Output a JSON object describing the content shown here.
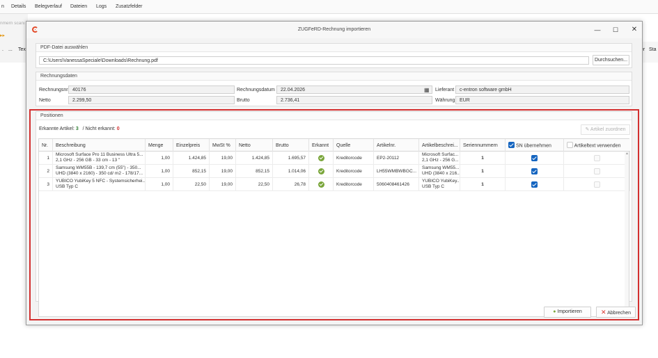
{
  "background": {
    "tabs": [
      {
        "label": "n"
      },
      {
        "label": "Details"
      },
      {
        "label": "Belegverlauf"
      },
      {
        "label": "Dateien"
      },
      {
        "label": "Logs"
      },
      {
        "label": "Zusatzfelder"
      }
    ],
    "scan_hint": "nmern scanı",
    "toolbar_snips": [
      ".",
      "...",
      "Tex"
    ],
    "right_snips": [
      "er",
      "Sta"
    ]
  },
  "dialog": {
    "title": "ZUGFeRD-Rechnung importieren",
    "pdf_group": {
      "title": "PDF-Datei auswählen",
      "path": "C:\\Users\\VanessaSpeciale\\Downloads\\Rechnung.pdf",
      "browse_label": "Durchsuchen..."
    },
    "invoice_group": {
      "title": "Rechnungsdaten",
      "number_label": "Rechnungsnr.",
      "number": "40176",
      "date_label": "Rechnungsdatum",
      "date": "22.04.2026",
      "supplier_label": "Lieferant",
      "supplier": "c-entron software gmbH",
      "net_label": "Netto",
      "net": "2.299,50",
      "gross_label": "Brutto",
      "gross": "2.736,41",
      "currency_label": "Währung",
      "currency": "EUR"
    },
    "positions": {
      "title": "Positionen",
      "recognized_label": "Erkannte Artikel:",
      "recognized_count": "3",
      "unrecognized_label": "/ Nicht erkannt:",
      "unrecognized_count": "0",
      "assign_label": "Artikel zuordnen",
      "columns": {
        "nr": "Nr.",
        "desc": "Beschreibung",
        "qty": "Menge",
        "unit": "Einzelpreis",
        "vat": "MwSt %",
        "net": "Netto",
        "gross": "Brutto",
        "recognized": "Erkannt",
        "source": "Quelle",
        "artno": "Artikelnr.",
        "artdesc": "Artikelbeschrei...",
        "serial": "Seriennummern",
        "sn": "SN übernehmen",
        "arttext": "Artikeltext verwenden"
      },
      "rows": [
        {
          "nr": "1",
          "desc1": "Microsoft Surface Pro 11 Business Ultra 5...",
          "desc2": "2,1 GHz - 256 GB - 33 cm - 13 \"",
          "qty": "1,00",
          "unit": "1.424,85",
          "vat": "19,00",
          "net": "1.424,85",
          "gross": "1.695,57",
          "source": "Kreditorcode",
          "artno": "EP2-20112",
          "artdesc1": "Microsoft Surfac...",
          "artdesc2": "2,1 GHz - 256 G...",
          "serial": "1",
          "sn": true,
          "arttext": false
        },
        {
          "nr": "2",
          "desc1": "Samsung WM55B - 139,7 cm (55\") - 350...",
          "desc2": "UHD (3840 x 2160) - 350 cd/ m2 - 178/17...",
          "qty": "1,00",
          "unit": "852,15",
          "vat": "19,00",
          "net": "852,15",
          "gross": "1.014,06",
          "source": "Kreditorcode",
          "artno": "LH55WMBWBGC...",
          "artdesc1": "Samsung WM55...",
          "artdesc2": "UHD (3840 x 216...",
          "serial": "1",
          "sn": true,
          "arttext": false
        },
        {
          "nr": "3",
          "desc1": "YUBICO YubiKey 5 NFC - Systemsicherhei...",
          "desc2": "USB Typ C",
          "qty": "1,00",
          "unit": "22,50",
          "vat": "19,00",
          "net": "22,50",
          "gross": "26,78",
          "source": "Kreditorcode",
          "artno": "5060408461426",
          "artdesc1": "YUBICO YubiKey...",
          "artdesc2": "USB Typ C",
          "serial": "1",
          "sn": true,
          "arttext": false
        }
      ]
    },
    "import_label": "Importieren",
    "cancel_label": "Abbrechen",
    "colors": {
      "accent": "#1565c0",
      "ok": "#7aa63b",
      "highlight": "#d32f2f",
      "logo": "#e34b2a",
      "cancel": "#d9322a"
    }
  }
}
